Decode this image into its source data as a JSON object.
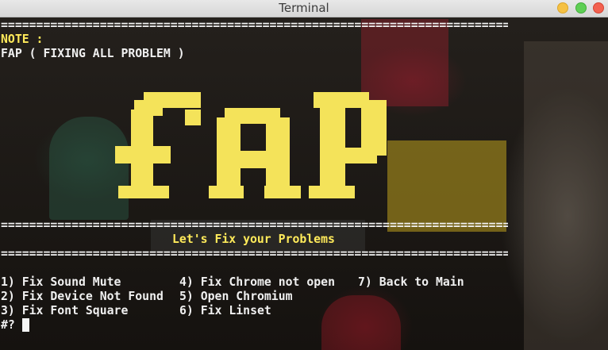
{
  "window": {
    "title": "Terminal"
  },
  "terminal": {
    "separator": "==============================================================================",
    "note_label": "NOTE :",
    "note_text": "FAP ( FIXING ALL PROBLEM )",
    "banner_text": "FAP",
    "heading": "Let's Fix your Problems",
    "menu": [
      {
        "label": "1) Fix Sound Mute"
      },
      {
        "label": "2) Fix Device Not Found"
      },
      {
        "label": "3) Fix Font Square"
      },
      {
        "label": "4) Fix Chrome not open"
      },
      {
        "label": "5) Open Chromium"
      },
      {
        "label": "6) Fix Linset"
      },
      {
        "label": "7) Back to Main"
      }
    ],
    "prompt": "#?"
  },
  "colors": {
    "accent_yellow": "#ffea5a",
    "terminal_text": "#f0f0f0"
  }
}
